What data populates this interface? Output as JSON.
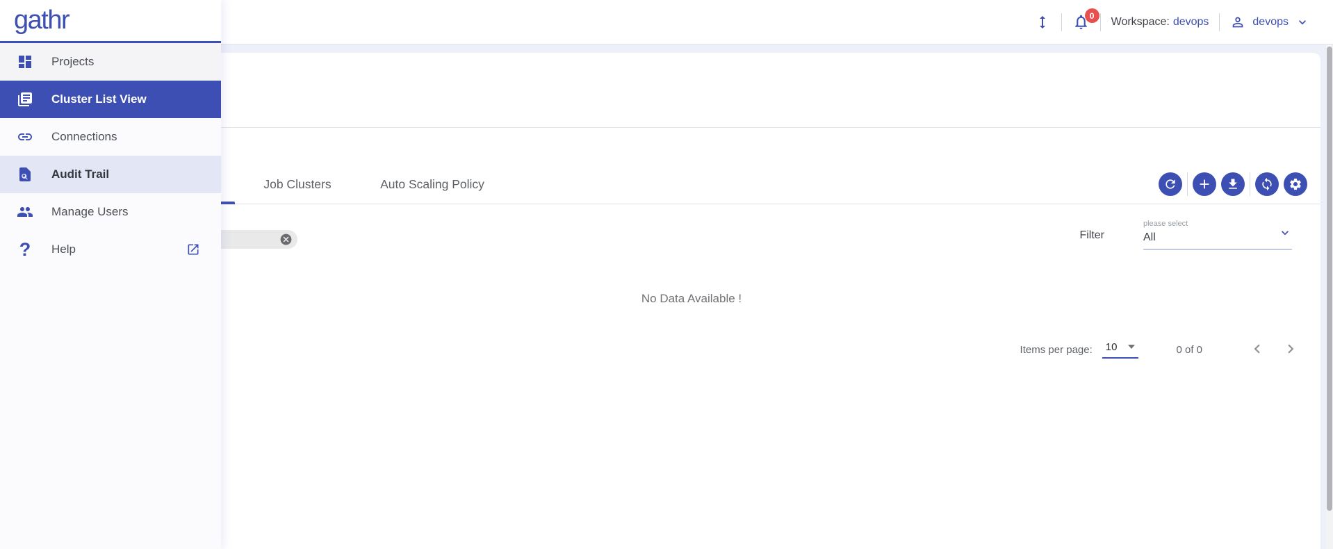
{
  "header": {
    "logo": "gathr",
    "notification_badge": "0",
    "workspace_label": "Workspace:",
    "workspace_value": "devops",
    "username": "devops",
    "icons": [
      "height-updown-icon",
      "bell-icon",
      "person-icon",
      "chevron-down-icon"
    ]
  },
  "sidebar": {
    "items": [
      {
        "label": "Projects",
        "icon": "dashboard-icon",
        "state": "normal"
      },
      {
        "label": "Cluster List View",
        "icon": "list-view-icon",
        "state": "selected"
      },
      {
        "label": "Connections",
        "icon": "link-icon",
        "state": "normal"
      },
      {
        "label": "Audit Trail",
        "icon": "audit-search-icon",
        "state": "highlighted"
      },
      {
        "label": "Manage Users",
        "icon": "people-icon",
        "state": "normal"
      },
      {
        "label": "Help",
        "icon": "question-mark-icon",
        "trailing_icon": "external-link-icon",
        "state": "normal"
      }
    ]
  },
  "main": {
    "tabs": [
      {
        "label": "Job Clusters",
        "selected": false
      },
      {
        "label": "Auto Scaling Policy",
        "selected": false
      }
    ],
    "toolbar_icons": [
      "refresh-icon",
      "add-icon",
      "download-icon",
      "sync-icon",
      "settings-icon"
    ],
    "search": {
      "value": "",
      "clear_icon": "clear-circle-icon"
    },
    "filter": {
      "label": "Filter",
      "select_label": "please select",
      "select_value": "All"
    },
    "empty_message": "No Data Available !",
    "pagination": {
      "items_per_page_label": "Items per page:",
      "items_per_page_value": "10",
      "range": "0 of 0"
    }
  },
  "colors": {
    "accent": "#3d4fb2",
    "badge_red": "#e85050",
    "selected_row": "#3d4fb2",
    "highlight_row": "#e3e6f4",
    "page_background": "#edeff9"
  }
}
